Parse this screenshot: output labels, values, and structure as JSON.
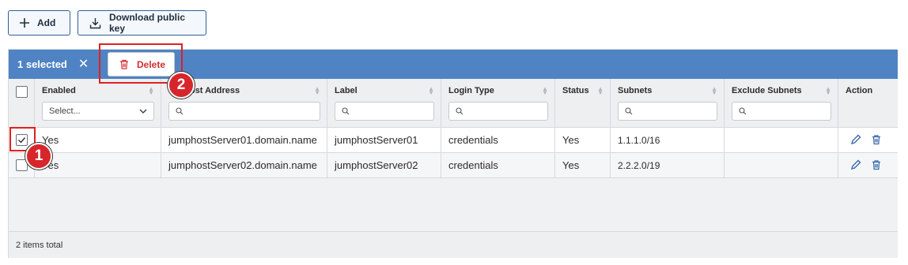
{
  "toolbar": {
    "add_label": "Add",
    "download_label": "Download public key"
  },
  "selection": {
    "count_label": "1 selected",
    "clear_icon": "✕",
    "delete_label": "Delete"
  },
  "annotations": {
    "step1": "1",
    "step2": "2"
  },
  "columns": {
    "enabled": "Enabled",
    "host": "Host Address",
    "label": "Label",
    "login_type": "Login Type",
    "status": "Status",
    "subnets": "Subnets",
    "exclude_subnets": "Exclude Subnets",
    "action": "Action"
  },
  "filters": {
    "enabled_placeholder": "Select..."
  },
  "rows": [
    {
      "enabled": "Yes",
      "host": "jumphostServer01.domain.name",
      "label": "jumphostServer01",
      "login_type": "credentials",
      "status": "Yes",
      "subnets": "1.1.1.0/16",
      "exclude_subnets": "",
      "checked": true
    },
    {
      "enabled": "Yes",
      "host": "jumphostServer02.domain.name",
      "label": "jumphostServer02",
      "login_type": "credentials",
      "status": "Yes",
      "subnets": "2.2.2.0/19",
      "exclude_subnets": "",
      "checked": false
    }
  ],
  "footer": {
    "total": "2 items total"
  },
  "colors": {
    "accent": "#4f83c4",
    "danger": "#d0302e",
    "annotation": "#e02020"
  }
}
